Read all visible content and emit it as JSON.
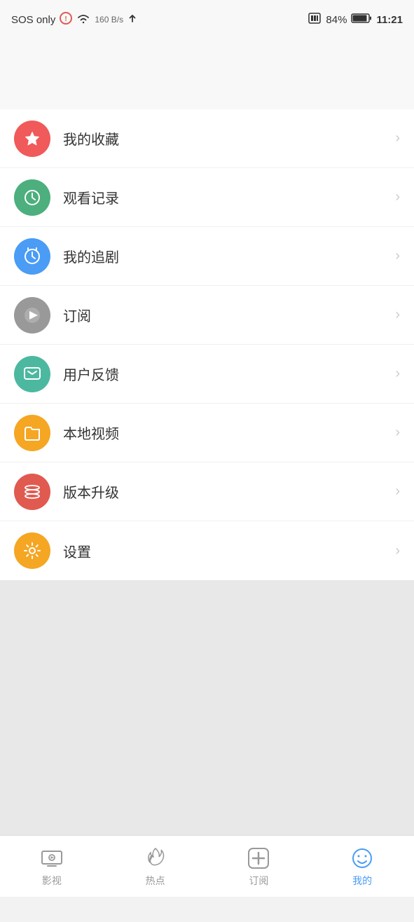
{
  "statusBar": {
    "left": "SOS only",
    "network": "160 B/s",
    "battery": "84%",
    "time": "11:21"
  },
  "menuItems": [
    {
      "id": "favorites",
      "label": "我的收藏",
      "iconColor": "bg-red",
      "iconType": "star"
    },
    {
      "id": "history",
      "label": "观看记录",
      "iconColor": "bg-green",
      "iconType": "clock"
    },
    {
      "id": "followdrama",
      "label": "我的追剧",
      "iconColor": "bg-blue",
      "iconType": "alarm"
    },
    {
      "id": "subscribe",
      "label": "订阅",
      "iconColor": "bg-gray",
      "iconType": "play"
    },
    {
      "id": "feedback",
      "label": "用户反馈",
      "iconColor": "bg-teal",
      "iconType": "chat"
    },
    {
      "id": "localvideo",
      "label": "本地视频",
      "iconColor": "bg-orange",
      "iconType": "folder"
    },
    {
      "id": "update",
      "label": "版本升级",
      "iconColor": "bg-layered",
      "iconType": "layers"
    },
    {
      "id": "settings",
      "label": "设置",
      "iconColor": "bg-orange",
      "iconType": "gear"
    }
  ],
  "tabBar": {
    "items": [
      {
        "id": "movies",
        "label": "影视",
        "iconType": "tv",
        "active": false
      },
      {
        "id": "hot",
        "label": "热点",
        "iconType": "fire",
        "active": false
      },
      {
        "id": "subscribe",
        "label": "订阅",
        "iconType": "plus-circle",
        "active": false
      },
      {
        "id": "mine",
        "label": "我的",
        "iconType": "smiley",
        "active": true
      }
    ]
  }
}
